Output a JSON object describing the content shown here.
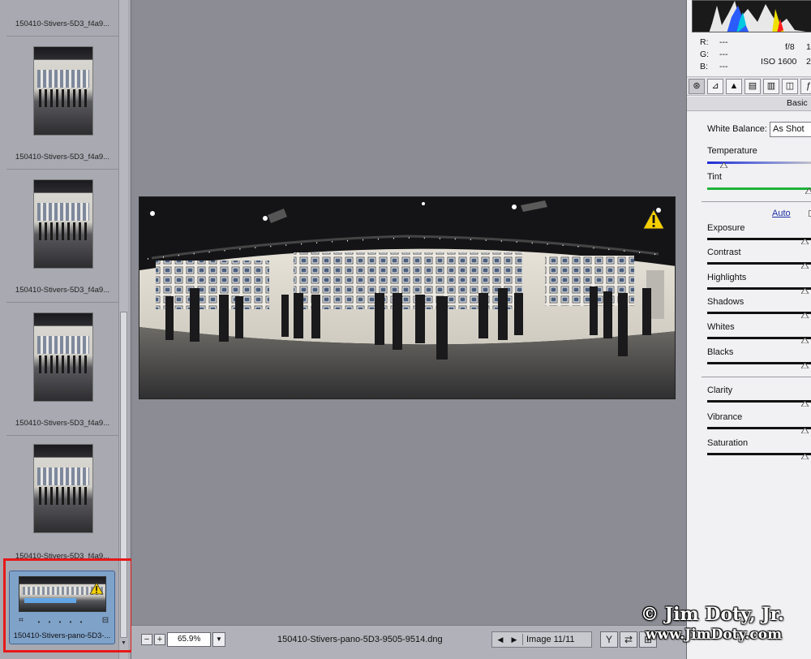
{
  "filmstrip": {
    "items": [
      {
        "name": "150410-Stivers-5D3_f4a9..."
      },
      {
        "name": "150410-Stivers-5D3_f4a9..."
      },
      {
        "name": "150410-Stivers-5D3_f4a9..."
      },
      {
        "name": "150410-Stivers-5D3_f4a9..."
      },
      {
        "name": "150410-Stivers-5D3_f4a9..."
      }
    ],
    "selected": {
      "name": "150410-Stivers-pano-5D3-...",
      "dots": "• • • • •",
      "warning_icon": "warning-icon"
    }
  },
  "bottom_bar": {
    "zoom_out": "−",
    "zoom_in": "+",
    "zoom_value": "65.9%",
    "zoom_dropdown": "▼",
    "filename": "150410-Stivers-pano-5D3-9505-9514.dng",
    "prev": "◀",
    "next": "▶",
    "image_count": "Image 11/11",
    "tool_a": "Y",
    "tool_b": "⇄",
    "tool_c": "⊞"
  },
  "readouts": {
    "r_label": "R:",
    "r_value": "---",
    "g_label": "G:",
    "g_value": "---",
    "b_label": "B:",
    "b_value": "---",
    "aperture": "f/8",
    "aperture_extra": "1",
    "iso": "ISO 1600",
    "iso_extra": "2"
  },
  "panel": {
    "tab_title": "Basic",
    "white_balance_label": "White Balance:",
    "white_balance_value": "As Shot",
    "auto_link": "Auto",
    "sliders": {
      "temperature": {
        "label": "Temperature",
        "level": 0.15
      },
      "tint": {
        "label": "Tint",
        "level": 1.0
      },
      "exposure": {
        "label": "Exposure",
        "level": 0.92
      },
      "contrast": {
        "label": "Contrast",
        "level": 0.92
      },
      "highlights": {
        "label": "Highlights",
        "level": 0.92
      },
      "shadows": {
        "label": "Shadows",
        "level": 0.92
      },
      "whites": {
        "label": "Whites",
        "level": 0.92
      },
      "blacks": {
        "label": "Blacks",
        "level": 0.92
      },
      "clarity": {
        "label": "Clarity",
        "level": 0.92
      },
      "vibrance": {
        "label": "Vibrance",
        "level": 0.92
      },
      "saturation": {
        "label": "Saturation",
        "level": 0.92
      }
    }
  },
  "watermark": {
    "line1": "© Jim Doty, Jr.",
    "line2": "www.JimDoty.com"
  },
  "colors": {
    "selection_highlight": "#e61919",
    "selected_item_bg": "#7fa2c9",
    "warning": "#f5d000",
    "temperature_track": "#1d2bd6",
    "tint_track": "#20b23a"
  }
}
